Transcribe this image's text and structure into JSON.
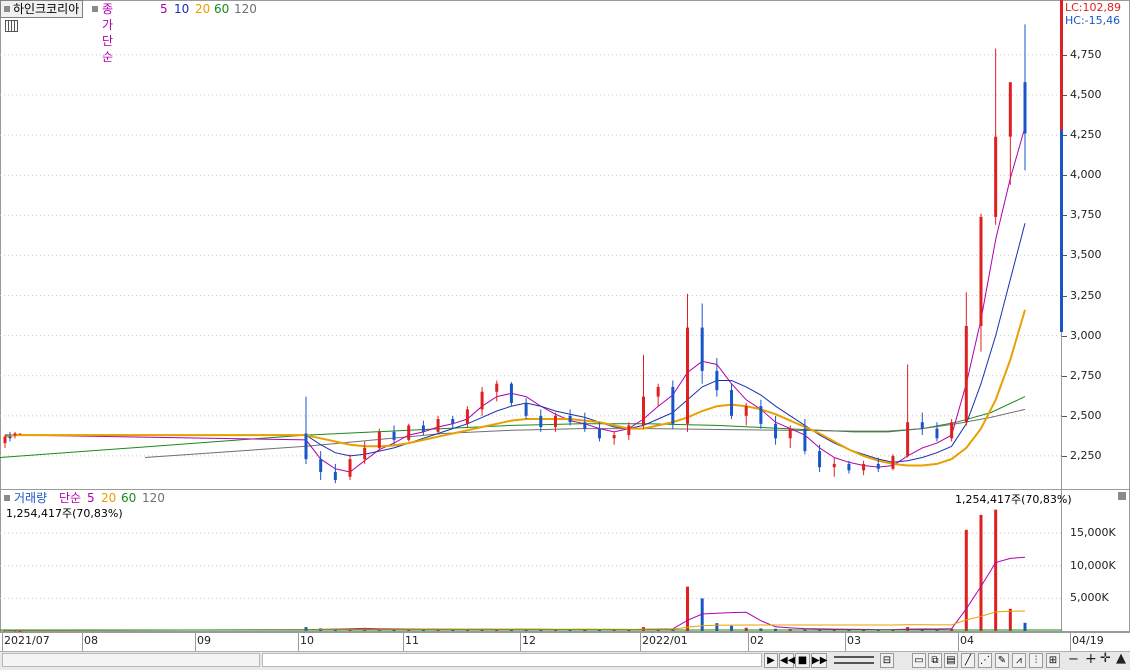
{
  "stock_name": "하인크코리아",
  "price_legend": {
    "label": "종가 단순",
    "periods": [
      {
        "text": "5",
        "color": "#b000b0"
      },
      {
        "text": "10",
        "color": "#1a2fb0"
      },
      {
        "text": "20",
        "color": "#e8a000"
      },
      {
        "text": "60",
        "color": "#1a8a1a"
      },
      {
        "text": "120",
        "color": "#707070"
      }
    ]
  },
  "volume_legend": {
    "label": "거래량",
    "label2": "단순",
    "periods": [
      {
        "text": "5",
        "color": "#b000b0"
      },
      {
        "text": "20",
        "color": "#e8a000"
      },
      {
        "text": "60",
        "color": "#1a8a1a"
      },
      {
        "text": "120",
        "color": "#707070"
      }
    ],
    "current_left": "1,254,417주(70,83%)",
    "current_right": "1,254,417주(70,83%)"
  },
  "lc_label": "LC:102,89",
  "hc_label": "HC:-15,46",
  "price_axis": [
    "4,750",
    "4,500",
    "4,250",
    "4,000",
    "3,750",
    "3,500",
    "3,250",
    "3,000",
    "2,750",
    "2,500",
    "2,250"
  ],
  "volume_axis": [
    "15,000K",
    "10,000K",
    "5,000K"
  ],
  "date_axis": [
    "2021/07",
    "08",
    "09",
    "10",
    "11",
    "12",
    "2022/01",
    "02",
    "03",
    "04",
    "04/19"
  ],
  "colors": {
    "up": "#e02020",
    "down": "#1a55c8",
    "grid": "#c8c8c8"
  },
  "chart_data": {
    "type": "candlestick",
    "title": "하인크코리아",
    "ylim": [
      2050,
      4980
    ],
    "volume_ylim": [
      0,
      19000
    ],
    "x": [
      "2021/07",
      "08",
      "09",
      "10",
      "11",
      "12",
      "2022/01",
      "02",
      "03",
      "04",
      "04/19"
    ],
    "candles": [
      [
        2330,
        2380,
        2300,
        2370,
        "2021/07",
        120
      ],
      [
        2370,
        2400,
        2340,
        2360,
        "",
        150
      ],
      [
        2380,
        2400,
        2360,
        2390,
        "",
        90
      ],
      [
        2390,
        2390,
        2390,
        2390,
        "",
        20
      ],
      [
        2390,
        2620,
        2200,
        2230,
        "10",
        600
      ],
      [
        2230,
        2280,
        2100,
        2150,
        "",
        400
      ],
      [
        2150,
        2200,
        2080,
        2100,
        "",
        350
      ],
      [
        2120,
        2260,
        2100,
        2230,
        "",
        300
      ],
      [
        2230,
        2340,
        2200,
        2300,
        "",
        320
      ],
      [
        2300,
        2420,
        2280,
        2400,
        "",
        350
      ],
      [
        2400,
        2440,
        2320,
        2350,
        "",
        280
      ],
      [
        2350,
        2450,
        2340,
        2440,
        "11",
        260
      ],
      [
        2440,
        2470,
        2380,
        2400,
        "",
        250
      ],
      [
        2400,
        2500,
        2390,
        2480,
        "",
        300
      ],
      [
        2480,
        2500,
        2420,
        2450,
        "",
        220
      ],
      [
        2450,
        2560,
        2430,
        2540,
        "",
        300
      ],
      [
        2540,
        2680,
        2500,
        2650,
        "",
        320
      ],
      [
        2650,
        2720,
        2590,
        2700,
        "",
        260
      ],
      [
        2700,
        2710,
        2560,
        2580,
        "",
        250
      ],
      [
        2580,
        2610,
        2480,
        2500,
        "12",
        240
      ],
      [
        2500,
        2540,
        2400,
        2430,
        "",
        220
      ],
      [
        2430,
        2520,
        2400,
        2500,
        "",
        210
      ],
      [
        2500,
        2540,
        2440,
        2460,
        "",
        200
      ],
      [
        2460,
        2520,
        2400,
        2420,
        "",
        190
      ],
      [
        2420,
        2460,
        2340,
        2360,
        "",
        180
      ],
      [
        2360,
        2400,
        2320,
        2380,
        "",
        160
      ],
      [
        2380,
        2460,
        2350,
        2440,
        "2022/01",
        170
      ],
      [
        2440,
        2880,
        2420,
        2620,
        "",
        600
      ],
      [
        2620,
        2700,
        2560,
        2680,
        "",
        350
      ],
      [
        2680,
        2720,
        2420,
        2450,
        "",
        300
      ],
      [
        2450,
        3260,
        2400,
        3050,
        "",
        6800
      ],
      [
        3050,
        3200,
        2700,
        2780,
        "",
        5000
      ],
      [
        2780,
        2860,
        2620,
        2660,
        "",
        1200
      ],
      [
        2660,
        2700,
        2480,
        2500,
        "02",
        800
      ],
      [
        2500,
        2580,
        2440,
        2560,
        "",
        500
      ],
      [
        2560,
        2600,
        2420,
        2450,
        "",
        400
      ],
      [
        2450,
        2500,
        2320,
        2360,
        "",
        350
      ],
      [
        2360,
        2440,
        2300,
        2420,
        "",
        300
      ],
      [
        2420,
        2480,
        2260,
        2280,
        "",
        280
      ],
      [
        2280,
        2320,
        2150,
        2180,
        "03",
        260
      ],
      [
        2180,
        2240,
        2120,
        2200,
        "",
        240
      ],
      [
        2200,
        2220,
        2140,
        2160,
        "",
        200
      ],
      [
        2160,
        2220,
        2130,
        2200,
        "",
        210
      ],
      [
        2200,
        2240,
        2150,
        2170,
        "",
        190
      ],
      [
        2170,
        2260,
        2160,
        2250,
        "",
        230
      ],
      [
        2250,
        2820,
        2240,
        2460,
        "",
        600
      ],
      [
        2460,
        2520,
        2380,
        2420,
        "",
        300
      ],
      [
        2420,
        2460,
        2340,
        2360,
        "",
        250
      ],
      [
        2360,
        2480,
        2340,
        2460,
        "04",
        350
      ],
      [
        2460,
        3270,
        2440,
        3060,
        "",
        15500
      ],
      [
        3060,
        3760,
        2900,
        3740,
        "",
        17800
      ],
      [
        3740,
        4790,
        3690,
        4240,
        "",
        18600
      ],
      [
        4240,
        4570,
        3940,
        4580,
        "",
        3400
      ],
      [
        4580,
        4940,
        4030,
        4260,
        "04/19",
        1254
      ]
    ],
    "ma": {
      "5": [
        2380,
        2380,
        2380,
        2380,
        2350,
        2230,
        2170,
        2150,
        2220,
        2290,
        2330,
        2380,
        2400,
        2430,
        2450,
        2480,
        2560,
        2620,
        2640,
        2620,
        2560,
        2510,
        2470,
        2450,
        2420,
        2400,
        2420,
        2480,
        2560,
        2630,
        2770,
        2840,
        2820,
        2700,
        2600,
        2540,
        2460,
        2420,
        2380,
        2300,
        2240,
        2210,
        2190,
        2180,
        2190,
        2250,
        2300,
        2330,
        2380,
        2700,
        3100,
        3600,
        3980,
        4300
      ],
      "10": [
        2380,
        2380,
        2380,
        2380,
        2380,
        2320,
        2270,
        2250,
        2260,
        2280,
        2300,
        2330,
        2360,
        2390,
        2420,
        2450,
        2490,
        2530,
        2560,
        2580,
        2560,
        2530,
        2510,
        2490,
        2460,
        2430,
        2420,
        2440,
        2480,
        2520,
        2600,
        2680,
        2720,
        2720,
        2680,
        2630,
        2560,
        2500,
        2440,
        2380,
        2330,
        2290,
        2260,
        2230,
        2210,
        2220,
        2240,
        2270,
        2310,
        2450,
        2700,
        3000,
        3350,
        3700
      ],
      "20": [
        2370,
        2375,
        2380,
        2380,
        2380,
        2360,
        2340,
        2320,
        2310,
        2310,
        2315,
        2330,
        2350,
        2370,
        2390,
        2410,
        2430,
        2450,
        2470,
        2480,
        2480,
        2480,
        2480,
        2470,
        2460,
        2440,
        2420,
        2420,
        2440,
        2460,
        2490,
        2530,
        2560,
        2570,
        2560,
        2540,
        2510,
        2470,
        2430,
        2390,
        2340,
        2290,
        2250,
        2220,
        2200,
        2190,
        2190,
        2200,
        2230,
        2300,
        2420,
        2600,
        2850,
        3160
      ]
    }
  }
}
